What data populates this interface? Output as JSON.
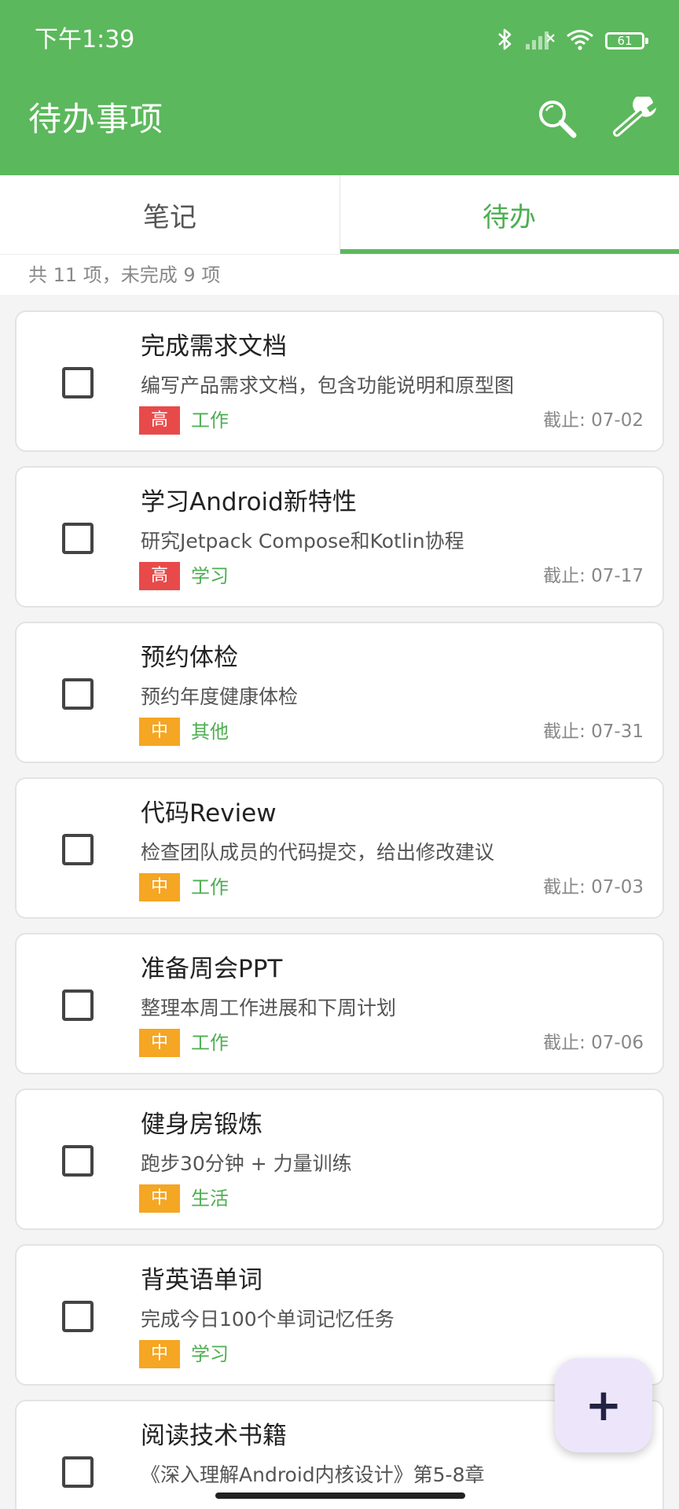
{
  "status_bar": {
    "time": "下午1:39",
    "battery": "61",
    "icons": [
      "bluetooth-icon",
      "signal-icon",
      "wifi-icon",
      "battery-icon"
    ]
  },
  "app_bar": {
    "title": "待办事项",
    "actions": [
      "search-icon",
      "wrench-icon"
    ],
    "color": "#5cb85c"
  },
  "tabs": [
    {
      "label": "笔记",
      "active": false
    },
    {
      "label": "待办",
      "active": true
    }
  ],
  "summary": "共 11 项，未完成 9 项",
  "todos": [
    {
      "title": "完成需求文档",
      "desc": "编写产品需求文档，包含功能说明和原型图",
      "priority": "高",
      "priority_level": "high",
      "category": "工作",
      "due": "截止: 07-02"
    },
    {
      "title": "学习Android新特性",
      "desc": "研究Jetpack Compose和Kotlin协程",
      "priority": "高",
      "priority_level": "high",
      "category": "学习",
      "due": "截止: 07-17"
    },
    {
      "title": "预约体检",
      "desc": "预约年度健康体检",
      "priority": "中",
      "priority_level": "mid",
      "category": "其他",
      "due": "截止: 07-31"
    },
    {
      "title": "代码Review",
      "desc": "检查团队成员的代码提交，给出修改建议",
      "priority": "中",
      "priority_level": "mid",
      "category": "工作",
      "due": "截止: 07-03"
    },
    {
      "title": "准备周会PPT",
      "desc": "整理本周工作进展和下周计划",
      "priority": "中",
      "priority_level": "mid",
      "category": "工作",
      "due": "截止: 07-06"
    },
    {
      "title": "健身房锻炼",
      "desc": "跑步30分钟 + 力量训练",
      "priority": "中",
      "priority_level": "mid",
      "category": "生活",
      "due": ""
    },
    {
      "title": "背英语单词",
      "desc": "完成今日100个单词记忆任务",
      "priority": "中",
      "priority_level": "mid",
      "category": "学习",
      "due": ""
    },
    {
      "title": "阅读技术书籍",
      "desc": "《深入理解Android内核设计》第5-8章",
      "priority": "",
      "priority_level": "",
      "category": "",
      "due": ""
    }
  ],
  "fab": {
    "label": "+",
    "icon": "plus-icon"
  },
  "colors": {
    "high": "#e84a4a",
    "mid": "#f5a623",
    "category": "#4caf50"
  }
}
